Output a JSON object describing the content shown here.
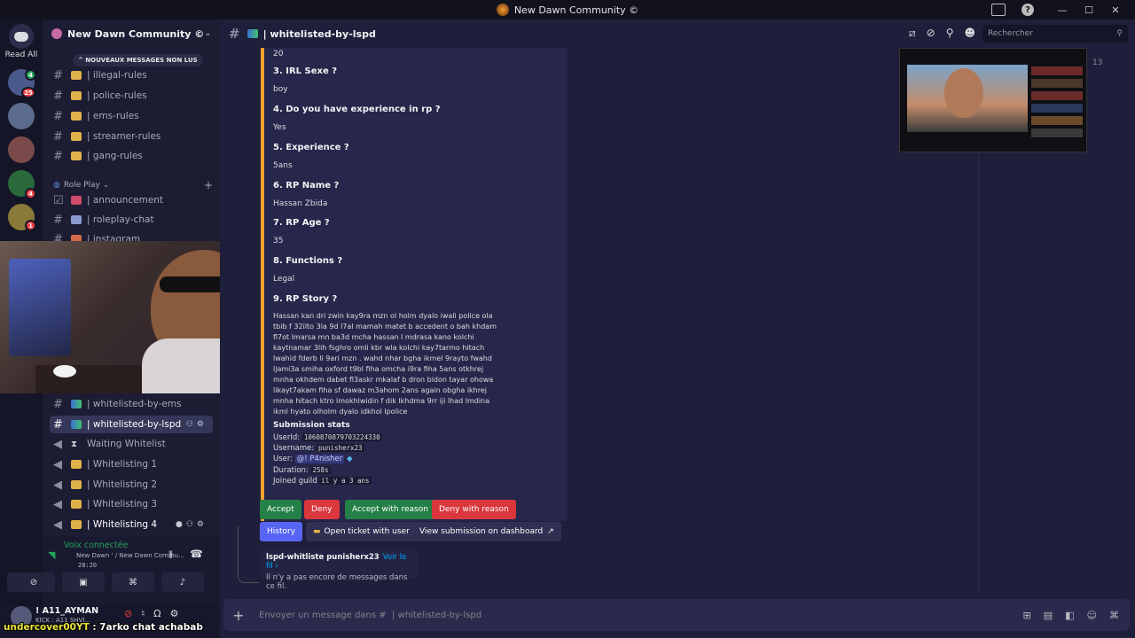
{
  "window": {
    "title": "New Dawn Community ©",
    "controls": [
      "—",
      "☐",
      "✕"
    ]
  },
  "guild_bar": {
    "read_all": "Read All",
    "guilds": [
      {
        "badge": "4",
        "color": "#4a5a8a"
      },
      {
        "badge": "25",
        "color": "#3b3f66"
      },
      {
        "badge": "",
        "color": "#5a6b8c"
      },
      {
        "badge": "",
        "color": "#7a4a4a"
      },
      {
        "badge": "4",
        "color": "#2a6a3a"
      },
      {
        "badge": "1",
        "color": "#8a7a3a"
      }
    ]
  },
  "sidebar": {
    "server_name": "New Dawn Community ©",
    "unread_pill": "^ NOUVEAUX MESSAGES NON LUS",
    "channels_top": [
      {
        "label": "| illegal-rules"
      },
      {
        "label": "| police-rules"
      },
      {
        "label": "| ems-rules"
      },
      {
        "label": "| streamer-rules"
      },
      {
        "label": "| gang-rules"
      }
    ],
    "category": "Role Play",
    "channels_rp": [
      {
        "label": "| announcement"
      },
      {
        "label": "| roleplay-chat"
      },
      {
        "label": "| instagram"
      }
    ],
    "channels_bottom": [
      {
        "label": "| whitelisted-by-ems"
      },
      {
        "label": "| whitelisted-by-lspd"
      },
      {
        "label": "Waiting Whitelist"
      },
      {
        "label": "| Whitelisting 1"
      },
      {
        "label": "| Whitelisting 2"
      },
      {
        "label": "| Whitelisting 3"
      },
      {
        "label": "| Whitelisting 4"
      }
    ]
  },
  "voice": {
    "title": "Voix connectée",
    "subtitle": "New Dawn ' / New Dawn Commu...",
    "time": "28:20"
  },
  "user": {
    "name": "! A11_AYMAN",
    "status": "KICK : A11 SHVI..."
  },
  "chat_overlay": {
    "user": "undercover00YT",
    "text": " : 7arko chat achabab"
  },
  "header": {
    "channel": "| whitelisted-by-lspd",
    "search_placeholder": "Rechercher"
  },
  "form": {
    "top_answer": "20",
    "items": [
      {
        "q": "3. IRL Sexe ?",
        "a": "boy"
      },
      {
        "q": "4. Do you have experience in rp ?",
        "a": "Yes"
      },
      {
        "q": "5. Experience ?",
        "a": "5ans"
      },
      {
        "q": "6. RP Name ?",
        "a": "Hassan Zbida"
      },
      {
        "q": "7. RP Age ?",
        "a": "35"
      },
      {
        "q": "8. Functions ?",
        "a": "Legal"
      }
    ],
    "story_q": "9. RP Story ?",
    "story": "Hassan kan dri zwin kay9ra mzn ol holm dyalo iwali police ola tbib f 32ilto 3la 9d l7al mamah matet b accedent o bah khdam fl7ot lmarsa mn ba3d mcha hassan l mdrasa kano kolchi kaytnamar 3lih fsghro omli kbr wla kolchi kay7tarmo hitach lwahid fderb li 9ari mzn . wahd nhar bgha ikmel 9rayto fwahd ljami3a smiha oxford t9bl fiha omcha i9ra fiha 5ans otkhrej mnha okhdem dabet fl3askr mkalaf b dron bidon tayar ohowa likayt7akam fiha sf dawaz m3ahom 2ans again obgha ikhrej mnha hitach ktro lmokhlwidin f dik lkhdma 9rr iji lhad lmdina ikml hyato olholm dyalo idkhol lpolice",
    "stats_title": "Submission stats",
    "stats": {
      "userid_label": "UserId:",
      "userid": "1060870879703224330",
      "username_label": "Username:",
      "username": "punisherx23",
      "user_label": "User:",
      "user": "@! P4nisher",
      "duration_label": "Duration:",
      "duration": "258s",
      "joined_label": "Joined guild",
      "joined": "il y a 3 ans"
    }
  },
  "actions": {
    "accept": "Accept",
    "deny": "Deny",
    "accept_reason": "Accept with reason",
    "deny_reason": "Deny with reason",
    "history": "History",
    "open_ticket": "Open ticket with user",
    "view_submission": "View submission on dashboard"
  },
  "thread": {
    "title": "lspd-whitliste punisherx23",
    "link": "Voir le fil ›",
    "empty": "Il n'y a pas encore de messages dans ce fil."
  },
  "stream": {
    "viewer_count": "13"
  },
  "composer": {
    "placeholder": "Envoyer un message dans #  | whitelisted-by-lspd"
  },
  "colors": {
    "accent_embed": "#f0a030",
    "green": "#248046",
    "red": "#da373c",
    "blurple": "#5865f2"
  }
}
